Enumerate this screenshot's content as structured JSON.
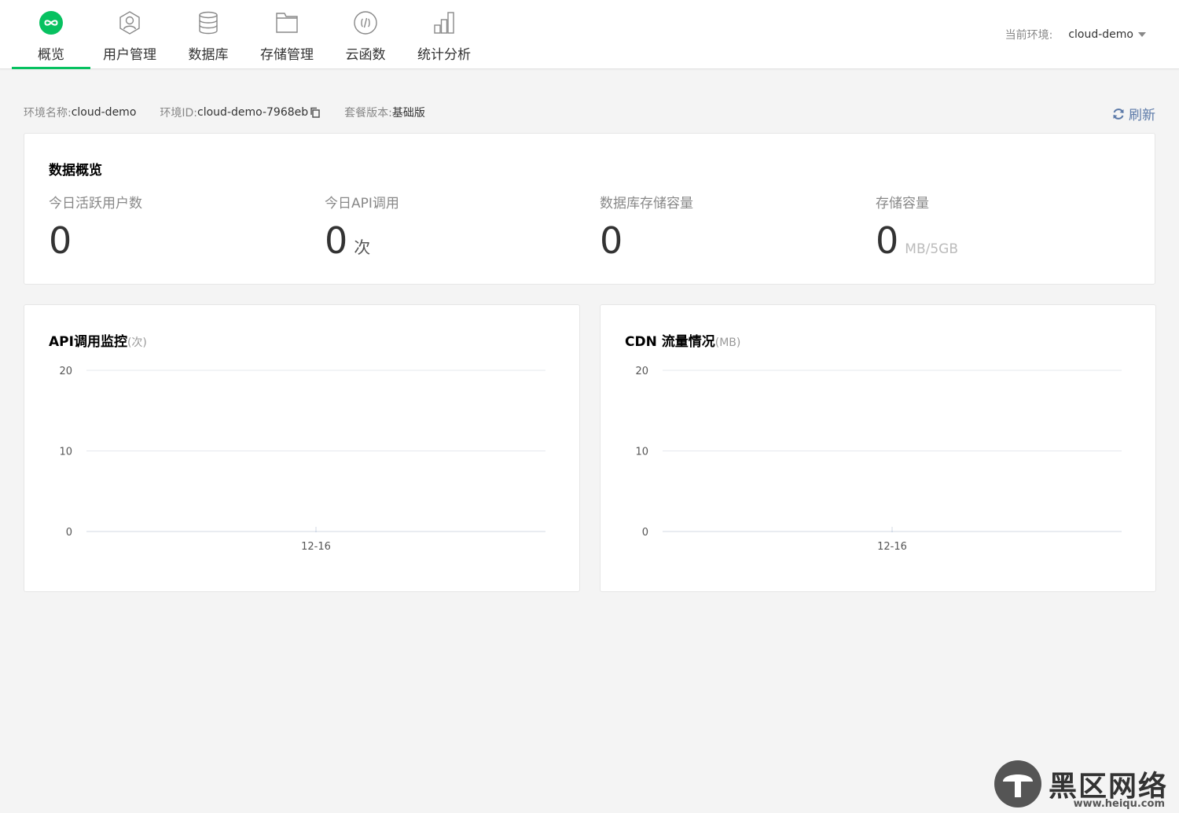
{
  "nav": {
    "items": [
      {
        "label": "概览",
        "icon": "infinity-icon",
        "active": true
      },
      {
        "label": "用户管理",
        "icon": "user-icon",
        "active": false
      },
      {
        "label": "数据库",
        "icon": "database-icon",
        "active": false
      },
      {
        "label": "存储管理",
        "icon": "folder-icon",
        "active": false
      },
      {
        "label": "云函数",
        "icon": "code-icon",
        "active": false
      },
      {
        "label": "统计分析",
        "icon": "bar-chart-icon",
        "active": false
      }
    ]
  },
  "env_switch": {
    "label": "当前环境:",
    "value": "cloud-demo"
  },
  "info_bar": {
    "env_name_label": "环境名称:",
    "env_name_value": "cloud-demo",
    "env_id_label": "环境ID:",
    "env_id_value": "cloud-demo-7968eb",
    "plan_label": "套餐版本:",
    "plan_value": "基础版",
    "refresh_label": "刷新"
  },
  "overview": {
    "title": "数据概览",
    "stats": [
      {
        "label": "今日活跃用户数",
        "value": "0",
        "unit": ""
      },
      {
        "label": "今日API调用",
        "value": "0",
        "unit": "次"
      },
      {
        "label": "数据库存储容量",
        "value": "0",
        "unit": ""
      },
      {
        "label": "存储容量",
        "value": "0",
        "unit": "MB/5GB"
      }
    ]
  },
  "charts": {
    "api": {
      "title": "API调用监控",
      "unit": "(次)"
    },
    "cdn": {
      "title": "CDN 流量情况",
      "unit": "(MB)"
    }
  },
  "chart_data": [
    {
      "type": "line",
      "title": "API调用监控(次)",
      "x": [
        "12-16"
      ],
      "series": [
        {
          "values": [
            0
          ]
        }
      ],
      "ylim": [
        0,
        20
      ],
      "yticks": [
        "0",
        "10",
        "20"
      ],
      "grid": true
    },
    {
      "type": "line",
      "title": "CDN 流量情况(MB)",
      "x": [
        "12-16"
      ],
      "series": [
        {
          "values": [
            0
          ]
        }
      ],
      "ylim": [
        0,
        20
      ],
      "yticks": [
        "0",
        "10",
        "20"
      ],
      "grid": true
    }
  ],
  "colors": {
    "accent": "#07c160",
    "link": "#5b79a8",
    "grid": "#e5e8ee"
  },
  "watermark": {
    "text": "黑区网络",
    "url": "www.heiqu.com"
  }
}
